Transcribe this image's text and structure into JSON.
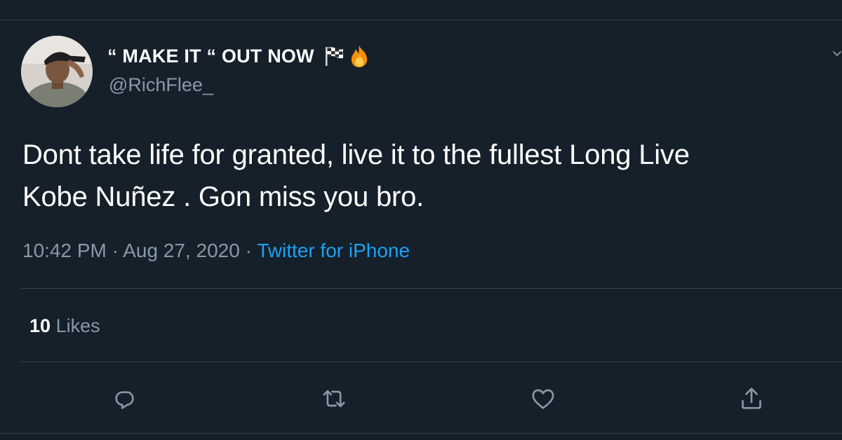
{
  "tweet": {
    "display_name": "“ MAKE IT “ OUT NOW",
    "name_icons": [
      "checkered-flag-icon",
      "fire-icon"
    ],
    "handle": "@RichFlee_",
    "text_line1": "Dont take life for granted, live it to the fullest Long Live",
    "text_line2": "Kobe Nuñez . Gon miss you bro.",
    "time": "10:42 PM",
    "dot": "·",
    "date": "Aug 27, 2020",
    "source": "Twitter for iPhone",
    "likes_count": "10",
    "likes_label": "Likes"
  },
  "actions": [
    "reply-icon",
    "retweet-icon",
    "like-icon",
    "share-icon"
  ],
  "colors": {
    "background": "#15202b",
    "border": "#38444d",
    "primary_text": "#ffffff",
    "secondary_text": "#8899a6",
    "link": "#1da1f2"
  }
}
